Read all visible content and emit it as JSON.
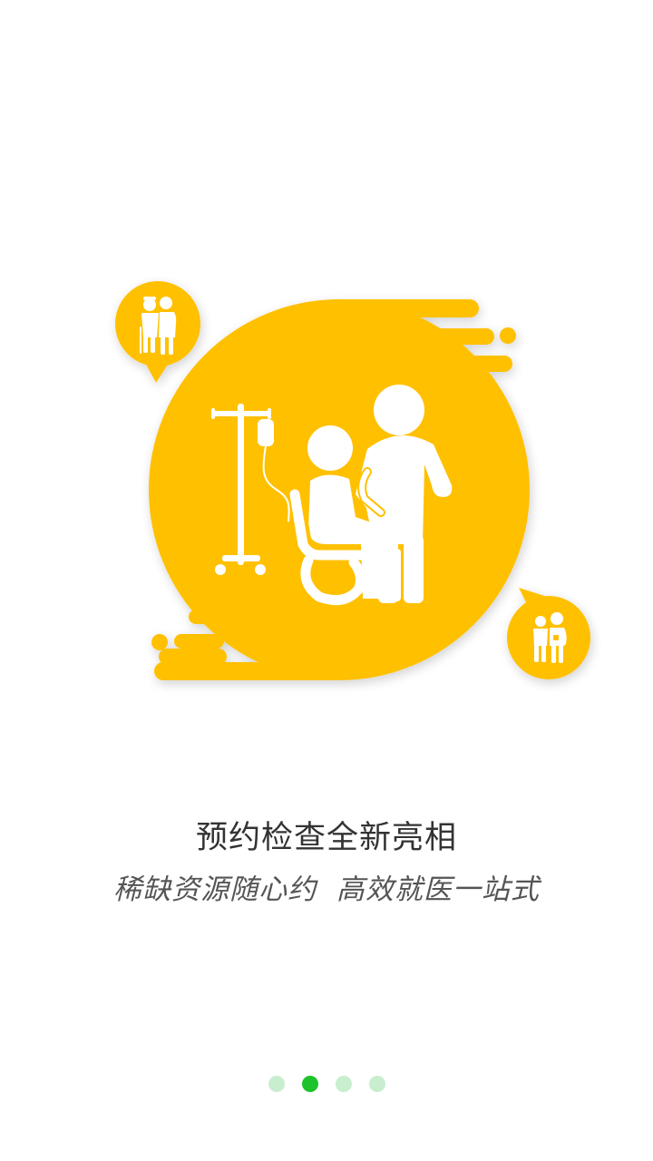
{
  "onboarding": {
    "title": "预约检查全新亮相",
    "subtitle": "稀缺资源随心约  高效就医一站式"
  },
  "pager": {
    "total": 4,
    "active_index": 1
  },
  "colors": {
    "illustration_yellow": "#FFC000",
    "dot_active": "#1EC22A",
    "dot_inactive": "#C8EECF",
    "title_text": "#333333",
    "subtitle_text": "#555555"
  },
  "icons": {
    "main": "wheelchair-iv-patient-icon",
    "bubble_top_left": "elderly-couple-icon",
    "bubble_bottom_right": "family-icon"
  }
}
